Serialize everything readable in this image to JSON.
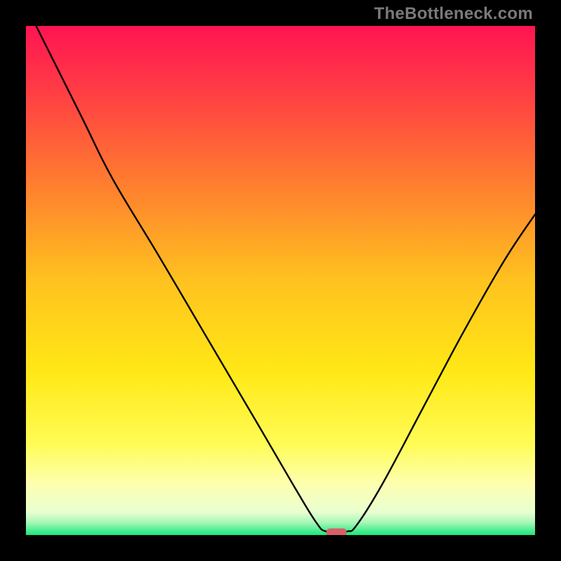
{
  "watermark": "TheBottleneck.com",
  "chart_data": {
    "type": "line",
    "title": "",
    "xlabel": "",
    "ylabel": "",
    "xlim": [
      0,
      100
    ],
    "ylim": [
      0,
      100
    ],
    "grid": false,
    "background": {
      "description": "vertical gradient with thin green band at bottom",
      "stops": [
        {
          "offset": 0.0,
          "color": "#ff1452"
        },
        {
          "offset": 0.12,
          "color": "#ff3a45"
        },
        {
          "offset": 0.3,
          "color": "#ff7a30"
        },
        {
          "offset": 0.5,
          "color": "#ffc21f"
        },
        {
          "offset": 0.68,
          "color": "#ffe816"
        },
        {
          "offset": 0.82,
          "color": "#fffc55"
        },
        {
          "offset": 0.9,
          "color": "#fdffb0"
        },
        {
          "offset": 0.955,
          "color": "#e9ffd0"
        },
        {
          "offset": 0.975,
          "color": "#a8f7b8"
        },
        {
          "offset": 1.0,
          "color": "#17e87a"
        }
      ]
    },
    "series": [
      {
        "name": "curve",
        "stroke": "#000000",
        "stroke_width": 2.4,
        "points": [
          {
            "x": 2.0,
            "y": 100.0
          },
          {
            "x": 11.0,
            "y": 82.0
          },
          {
            "x": 17.0,
            "y": 70.0
          },
          {
            "x": 26.0,
            "y": 55.0
          },
          {
            "x": 36.0,
            "y": 38.0
          },
          {
            "x": 46.0,
            "y": 21.0
          },
          {
            "x": 53.0,
            "y": 9.0
          },
          {
            "x": 57.0,
            "y": 2.5
          },
          {
            "x": 59.0,
            "y": 0.7
          },
          {
            "x": 63.0,
            "y": 0.7
          },
          {
            "x": 65.0,
            "y": 2.0
          },
          {
            "x": 70.0,
            "y": 10.0
          },
          {
            "x": 78.0,
            "y": 25.0
          },
          {
            "x": 86.0,
            "y": 40.0
          },
          {
            "x": 94.0,
            "y": 54.0
          },
          {
            "x": 100.0,
            "y": 63.0
          }
        ]
      }
    ],
    "markers": [
      {
        "name": "optimum-marker",
        "shape": "rounded-rect",
        "cx": 61.0,
        "cy": 0.5,
        "w": 4.0,
        "h": 1.6,
        "fill": "#d6606a"
      }
    ]
  }
}
